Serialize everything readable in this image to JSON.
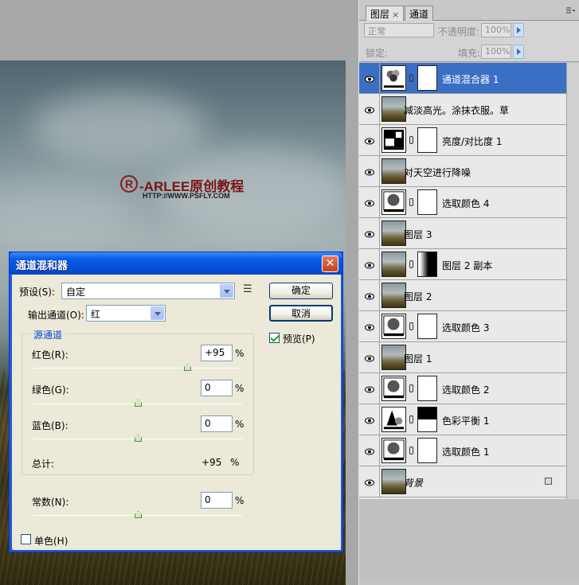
{
  "watermark": {
    "logo_mark": "R",
    "brand": "-ARLEE原创教程",
    "url": "HTTP://WWW.PSFLY.COM"
  },
  "dialog": {
    "title": "通道混和器",
    "preset_label": "预设(S):",
    "preset_value": "自定",
    "output_channel_label": "输出通道(O):",
    "output_channel_value": "红",
    "ok_label": "确定",
    "cancel_label": "取消",
    "preview_label": "预览(P)",
    "preview_checked": true,
    "source_group_label": "源通道",
    "channels": [
      {
        "label": "红色(R):",
        "value": "+95",
        "unit": "%",
        "slider_pct": 95
      },
      {
        "label": "绿色(G):",
        "value": "0",
        "unit": "%",
        "slider_pct": 0
      },
      {
        "label": "蓝色(B):",
        "value": "0",
        "unit": "%",
        "slider_pct": 0
      }
    ],
    "total_label": "总计:",
    "total_value": "+95",
    "total_unit": "%",
    "constant_label": "常数(N):",
    "constant_value": "0",
    "constant_unit": "%",
    "constant_slider_pct": 0,
    "monochrome_label": "单色(H)",
    "monochrome_checked": false
  },
  "layers_panel": {
    "tabs": [
      {
        "label": "图层",
        "close": "×",
        "active": true
      },
      {
        "label": "通道",
        "active": false
      }
    ],
    "blend_mode": "正常",
    "opacity_label": "不透明度:",
    "opacity_value": "100%",
    "lock_label": "锁定:",
    "fill_label": "填充:",
    "fill_value": "100%",
    "layers": [
      {
        "name": "通道混合器 1",
        "kind": "adjustment",
        "icon": "channel-mixer-icon",
        "mask": "white",
        "selected": true
      },
      {
        "name": "减淡高光。涂抹衣服。草",
        "kind": "photo",
        "selected": false
      },
      {
        "name": "亮度/对比度 1",
        "kind": "adjustment",
        "icon": "brightness-contrast-icon",
        "mask": "white",
        "selected": false
      },
      {
        "name": "对天空进行降噪",
        "kind": "photo",
        "selected": false
      },
      {
        "name": "选取颜色 4",
        "kind": "adjustment",
        "icon": "selective-color-icon",
        "mask": "white",
        "selected": false
      },
      {
        "name": "图层 3",
        "kind": "photo",
        "selected": false
      },
      {
        "name": "图层 2 副本",
        "kind": "photo-mask",
        "mask": "gradient",
        "selected": false
      },
      {
        "name": "图层 2",
        "kind": "photo",
        "selected": false
      },
      {
        "name": "选取颜色 3",
        "kind": "adjustment",
        "icon": "selective-color-icon",
        "mask": "white",
        "selected": false
      },
      {
        "name": "图层 1",
        "kind": "photo",
        "selected": false
      },
      {
        "name": "选取颜色 2",
        "kind": "adjustment",
        "icon": "selective-color-icon",
        "mask": "white",
        "selected": false
      },
      {
        "name": "色彩平衡 1",
        "kind": "adjustment",
        "icon": "color-balance-icon",
        "mask": "balance",
        "selected": false
      },
      {
        "name": "选取颜色 1",
        "kind": "adjustment",
        "icon": "selective-color-icon",
        "mask": "white",
        "selected": false
      },
      {
        "name": "背景",
        "kind": "background",
        "locked": true,
        "selected": false
      }
    ]
  },
  "colors": {
    "selected_layer": "#3b6fc4",
    "dialog_title_blue": "#0551d9",
    "watermark_red": "#7a1414"
  }
}
